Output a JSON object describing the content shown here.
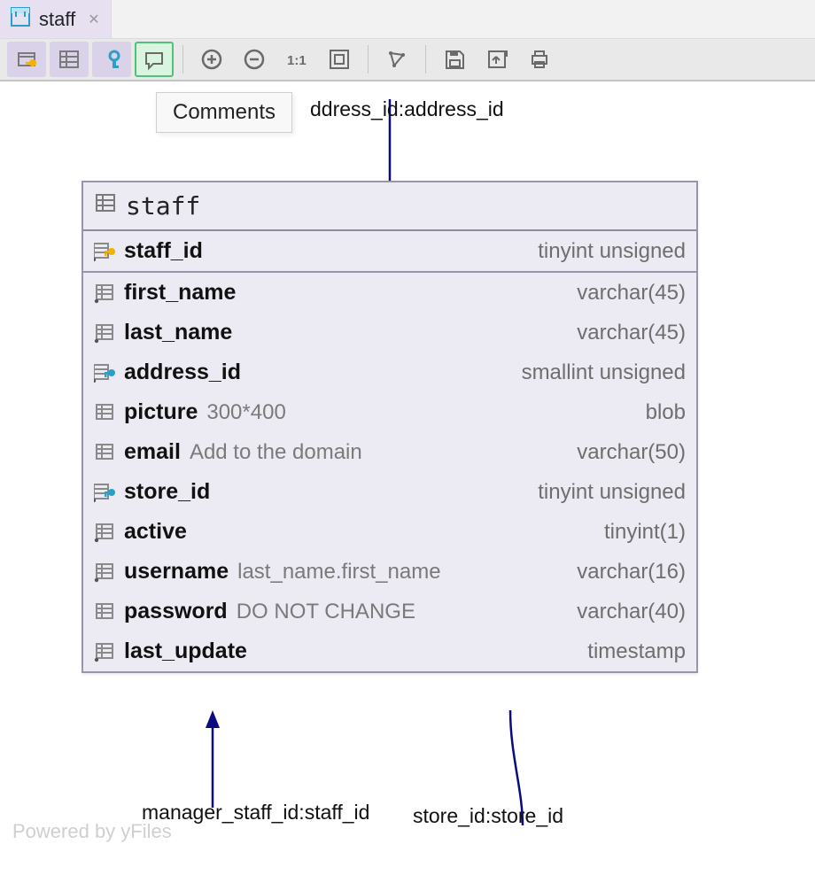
{
  "tab": {
    "title": "staff"
  },
  "tooltip": {
    "label": "Comments"
  },
  "relations": {
    "top": "ddress_id:address_id",
    "bottom_left": "manager_staff_id:staff_id",
    "bottom_right": "store_id:store_id"
  },
  "entity": {
    "title": "staff",
    "columns": [
      {
        "name": "staff_id",
        "type": "tinyint unsigned",
        "comment": "",
        "icon": "pk"
      },
      {
        "name": "first_name",
        "type": "varchar(45)",
        "comment": "",
        "icon": "col"
      },
      {
        "name": "last_name",
        "type": "varchar(45)",
        "comment": "",
        "icon": "col"
      },
      {
        "name": "address_id",
        "type": "smallint unsigned",
        "comment": "",
        "icon": "fk"
      },
      {
        "name": "picture",
        "type": "blob",
        "comment": "300*400",
        "icon": "col-nn"
      },
      {
        "name": "email",
        "type": "varchar(50)",
        "comment": "Add to the domain",
        "icon": "col-nn"
      },
      {
        "name": "store_id",
        "type": "tinyint unsigned",
        "comment": "",
        "icon": "fk"
      },
      {
        "name": "active",
        "type": "tinyint(1)",
        "comment": "",
        "icon": "col"
      },
      {
        "name": "username",
        "type": "varchar(16)",
        "comment": "last_name.first_name",
        "icon": "col"
      },
      {
        "name": "password",
        "type": "varchar(40)",
        "comment": "DO NOT CHANGE",
        "icon": "col-nn"
      },
      {
        "name": "last_update",
        "type": "timestamp",
        "comment": "",
        "icon": "col"
      }
    ]
  },
  "footer": {
    "powered": "Powered by yFiles"
  }
}
